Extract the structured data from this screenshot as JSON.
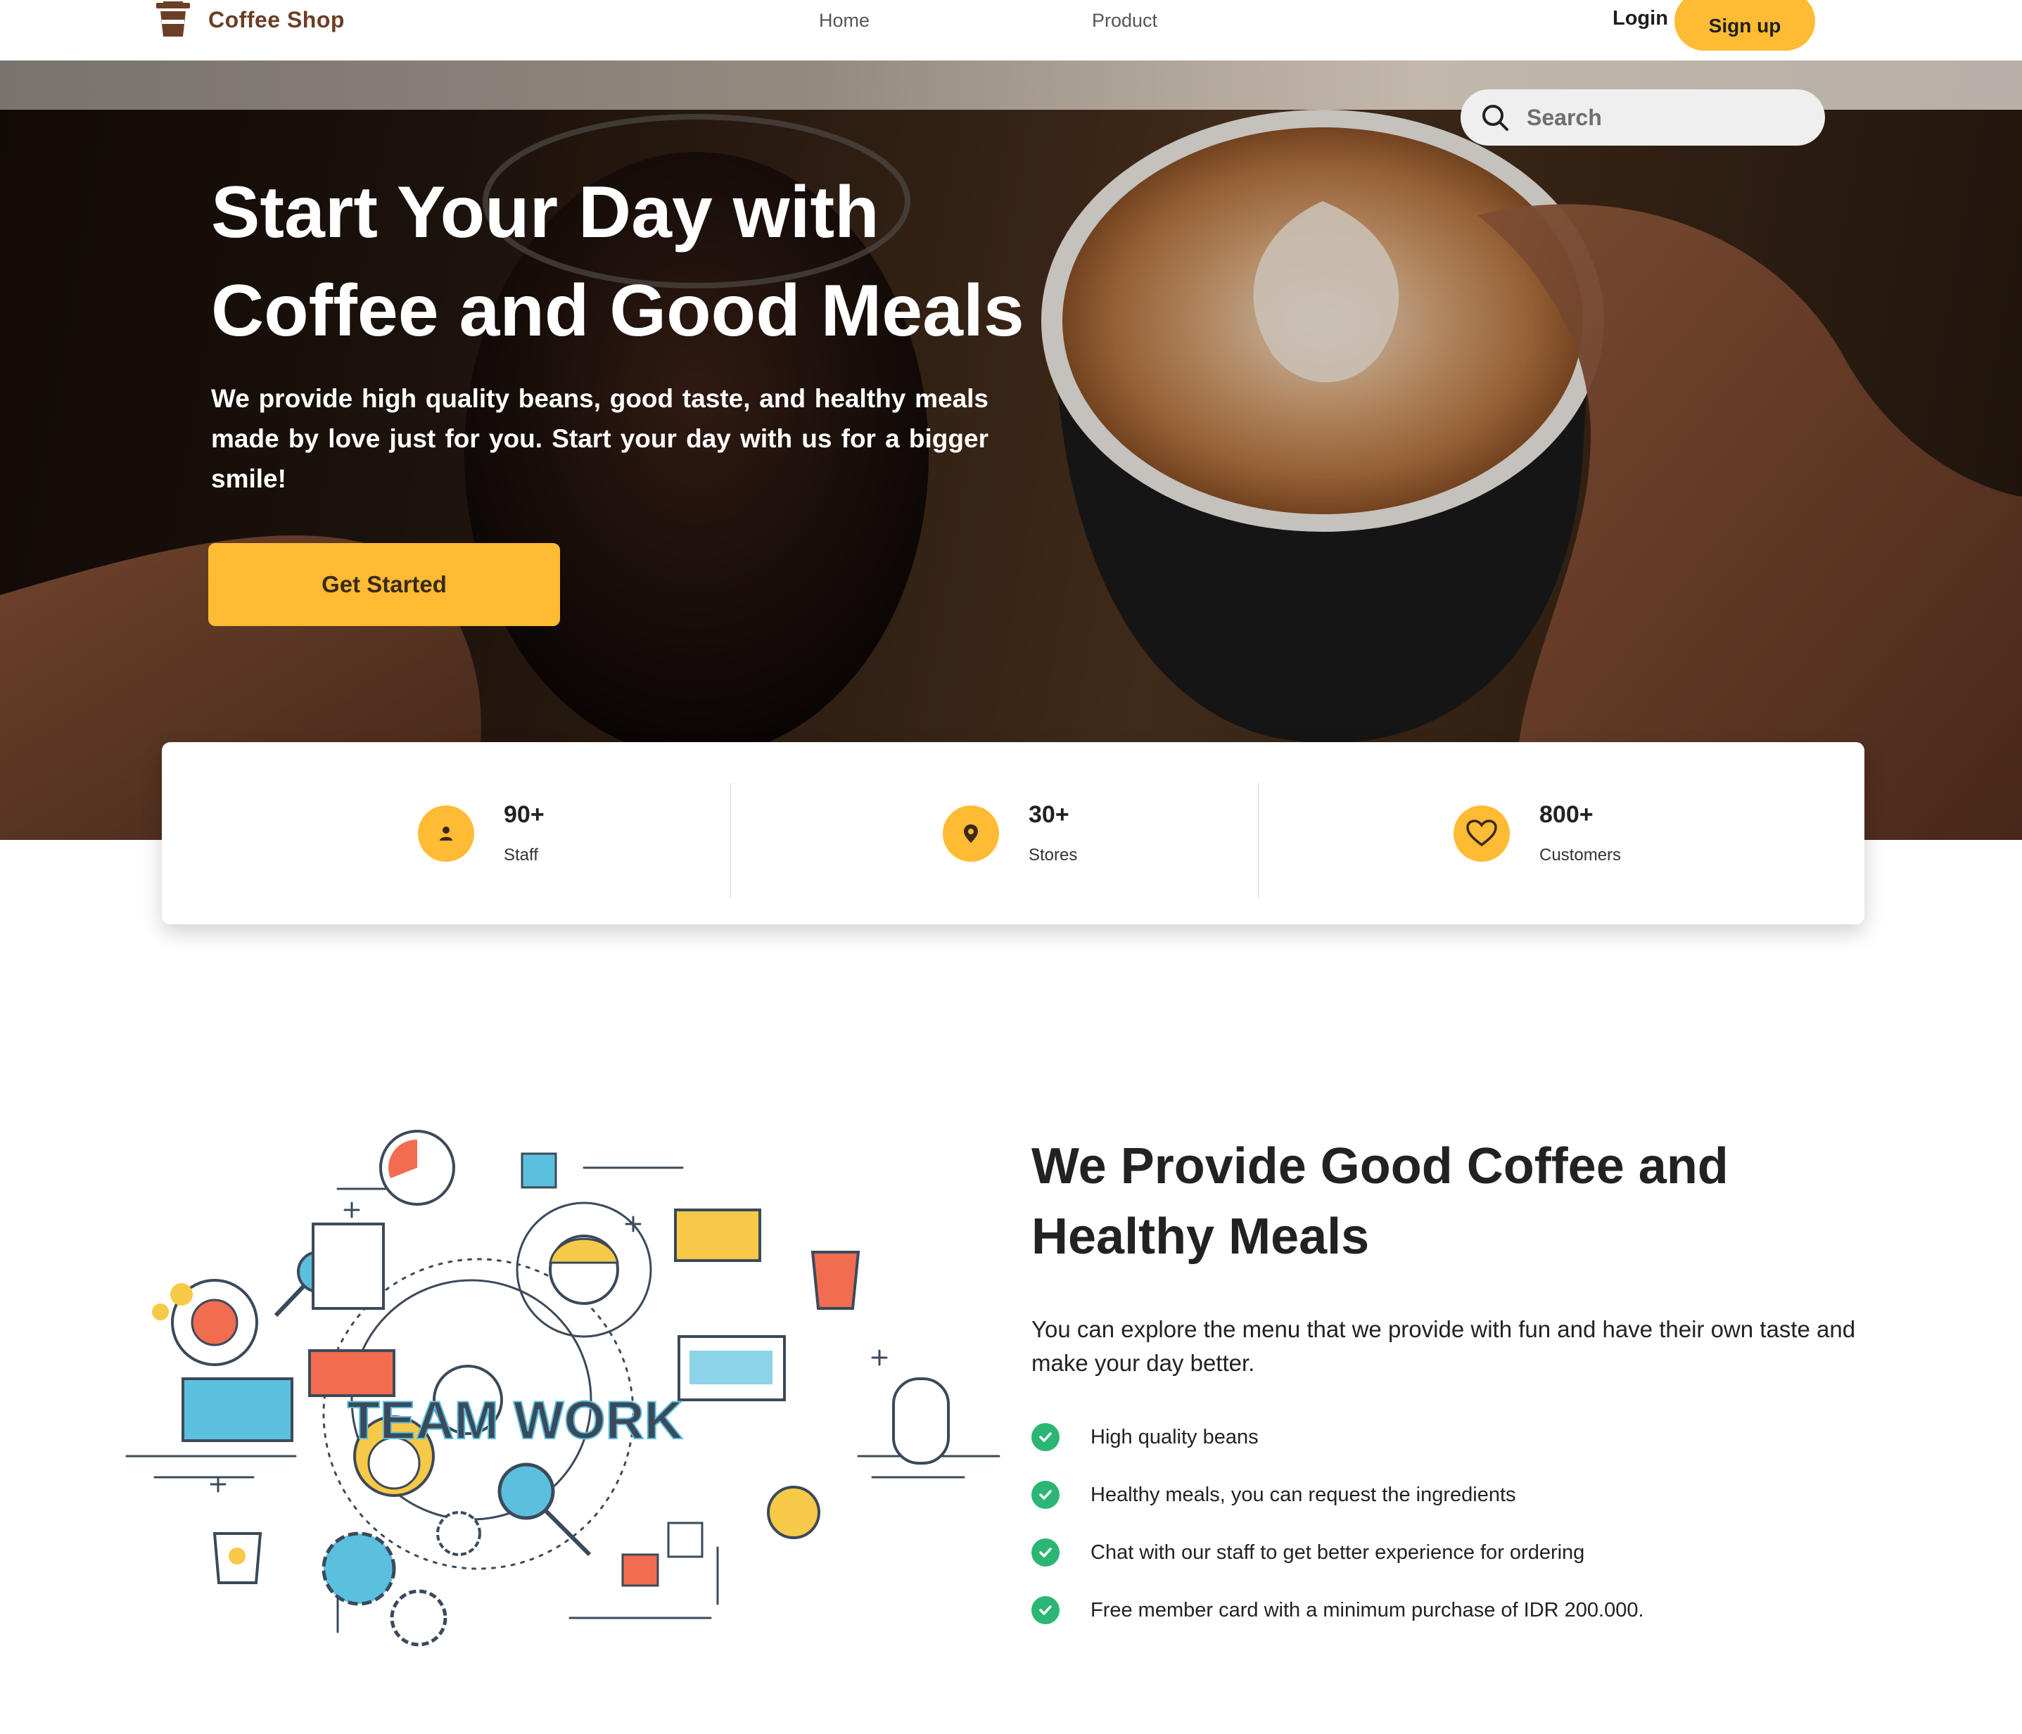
{
  "colors": {
    "accent": "#ffbb33",
    "brand_brown": "#6b3e26",
    "check_green": "#2bb673"
  },
  "nav": {
    "brand": "Coffee Shop",
    "links": [
      "Home",
      "Product"
    ],
    "login": "Login",
    "signup": "Sign up"
  },
  "search": {
    "placeholder": "Search",
    "icon": "search-icon"
  },
  "hero": {
    "title_line1": "Start Your Day with",
    "title_line2": "Coffee and Good Meals",
    "subtitle": "We provide high quality beans, good taste, and healthy meals made by love just for you. Start your day with us for a bigger smile!",
    "cta": "Get Started"
  },
  "stats": [
    {
      "value": "90+",
      "label": "Staff",
      "icon": "person-icon"
    },
    {
      "value": "30+",
      "label": "Stores",
      "icon": "map-pin-icon"
    },
    {
      "value": "800+",
      "label": "Customers",
      "icon": "heart-icon"
    }
  ],
  "feature": {
    "illustration_text": "TEAM WORK",
    "title_line1": "We Provide Good Coffee and",
    "title_line2": "Healthy Meals",
    "description": "You can explore the menu that we provide with fun and have their own taste and make your day better.",
    "items": [
      "High quality beans",
      "Healthy meals, you can request the ingredients",
      "Chat with our staff to get better experience for ordering",
      "Free member card with a minimum purchase of IDR 200.000."
    ]
  }
}
